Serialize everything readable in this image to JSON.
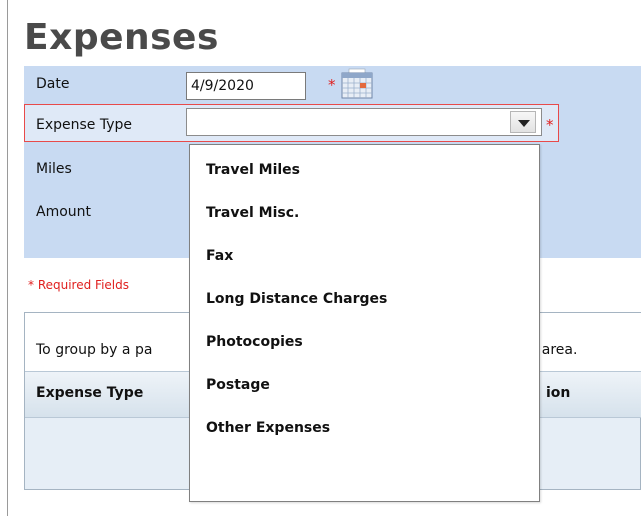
{
  "page": {
    "title": "Expenses"
  },
  "form": {
    "date_label": "Date",
    "date_value": "4/9/2020",
    "expense_type_label": "Expense Type",
    "expense_type_value": "",
    "miles_label": "Miles",
    "amount_label": "Amount",
    "required_marker": "*"
  },
  "required_note": "* Required Fields",
  "grid": {
    "group_hint_start": "To group by a pa",
    "group_hint_end": "s area.",
    "columns": [
      "Expense Type",
      "ion"
    ]
  },
  "dropdown": {
    "options": [
      "Travel Miles",
      "Travel Misc.",
      "Fax",
      "Long Distance Charges",
      "Photocopies",
      "Postage",
      "Other Expenses"
    ]
  },
  "colors": {
    "panel": "#c8daf2",
    "required": "#e0201f",
    "title": "#4a4a4a"
  },
  "icons": [
    "calendar-icon",
    "chevron-down-icon"
  ]
}
